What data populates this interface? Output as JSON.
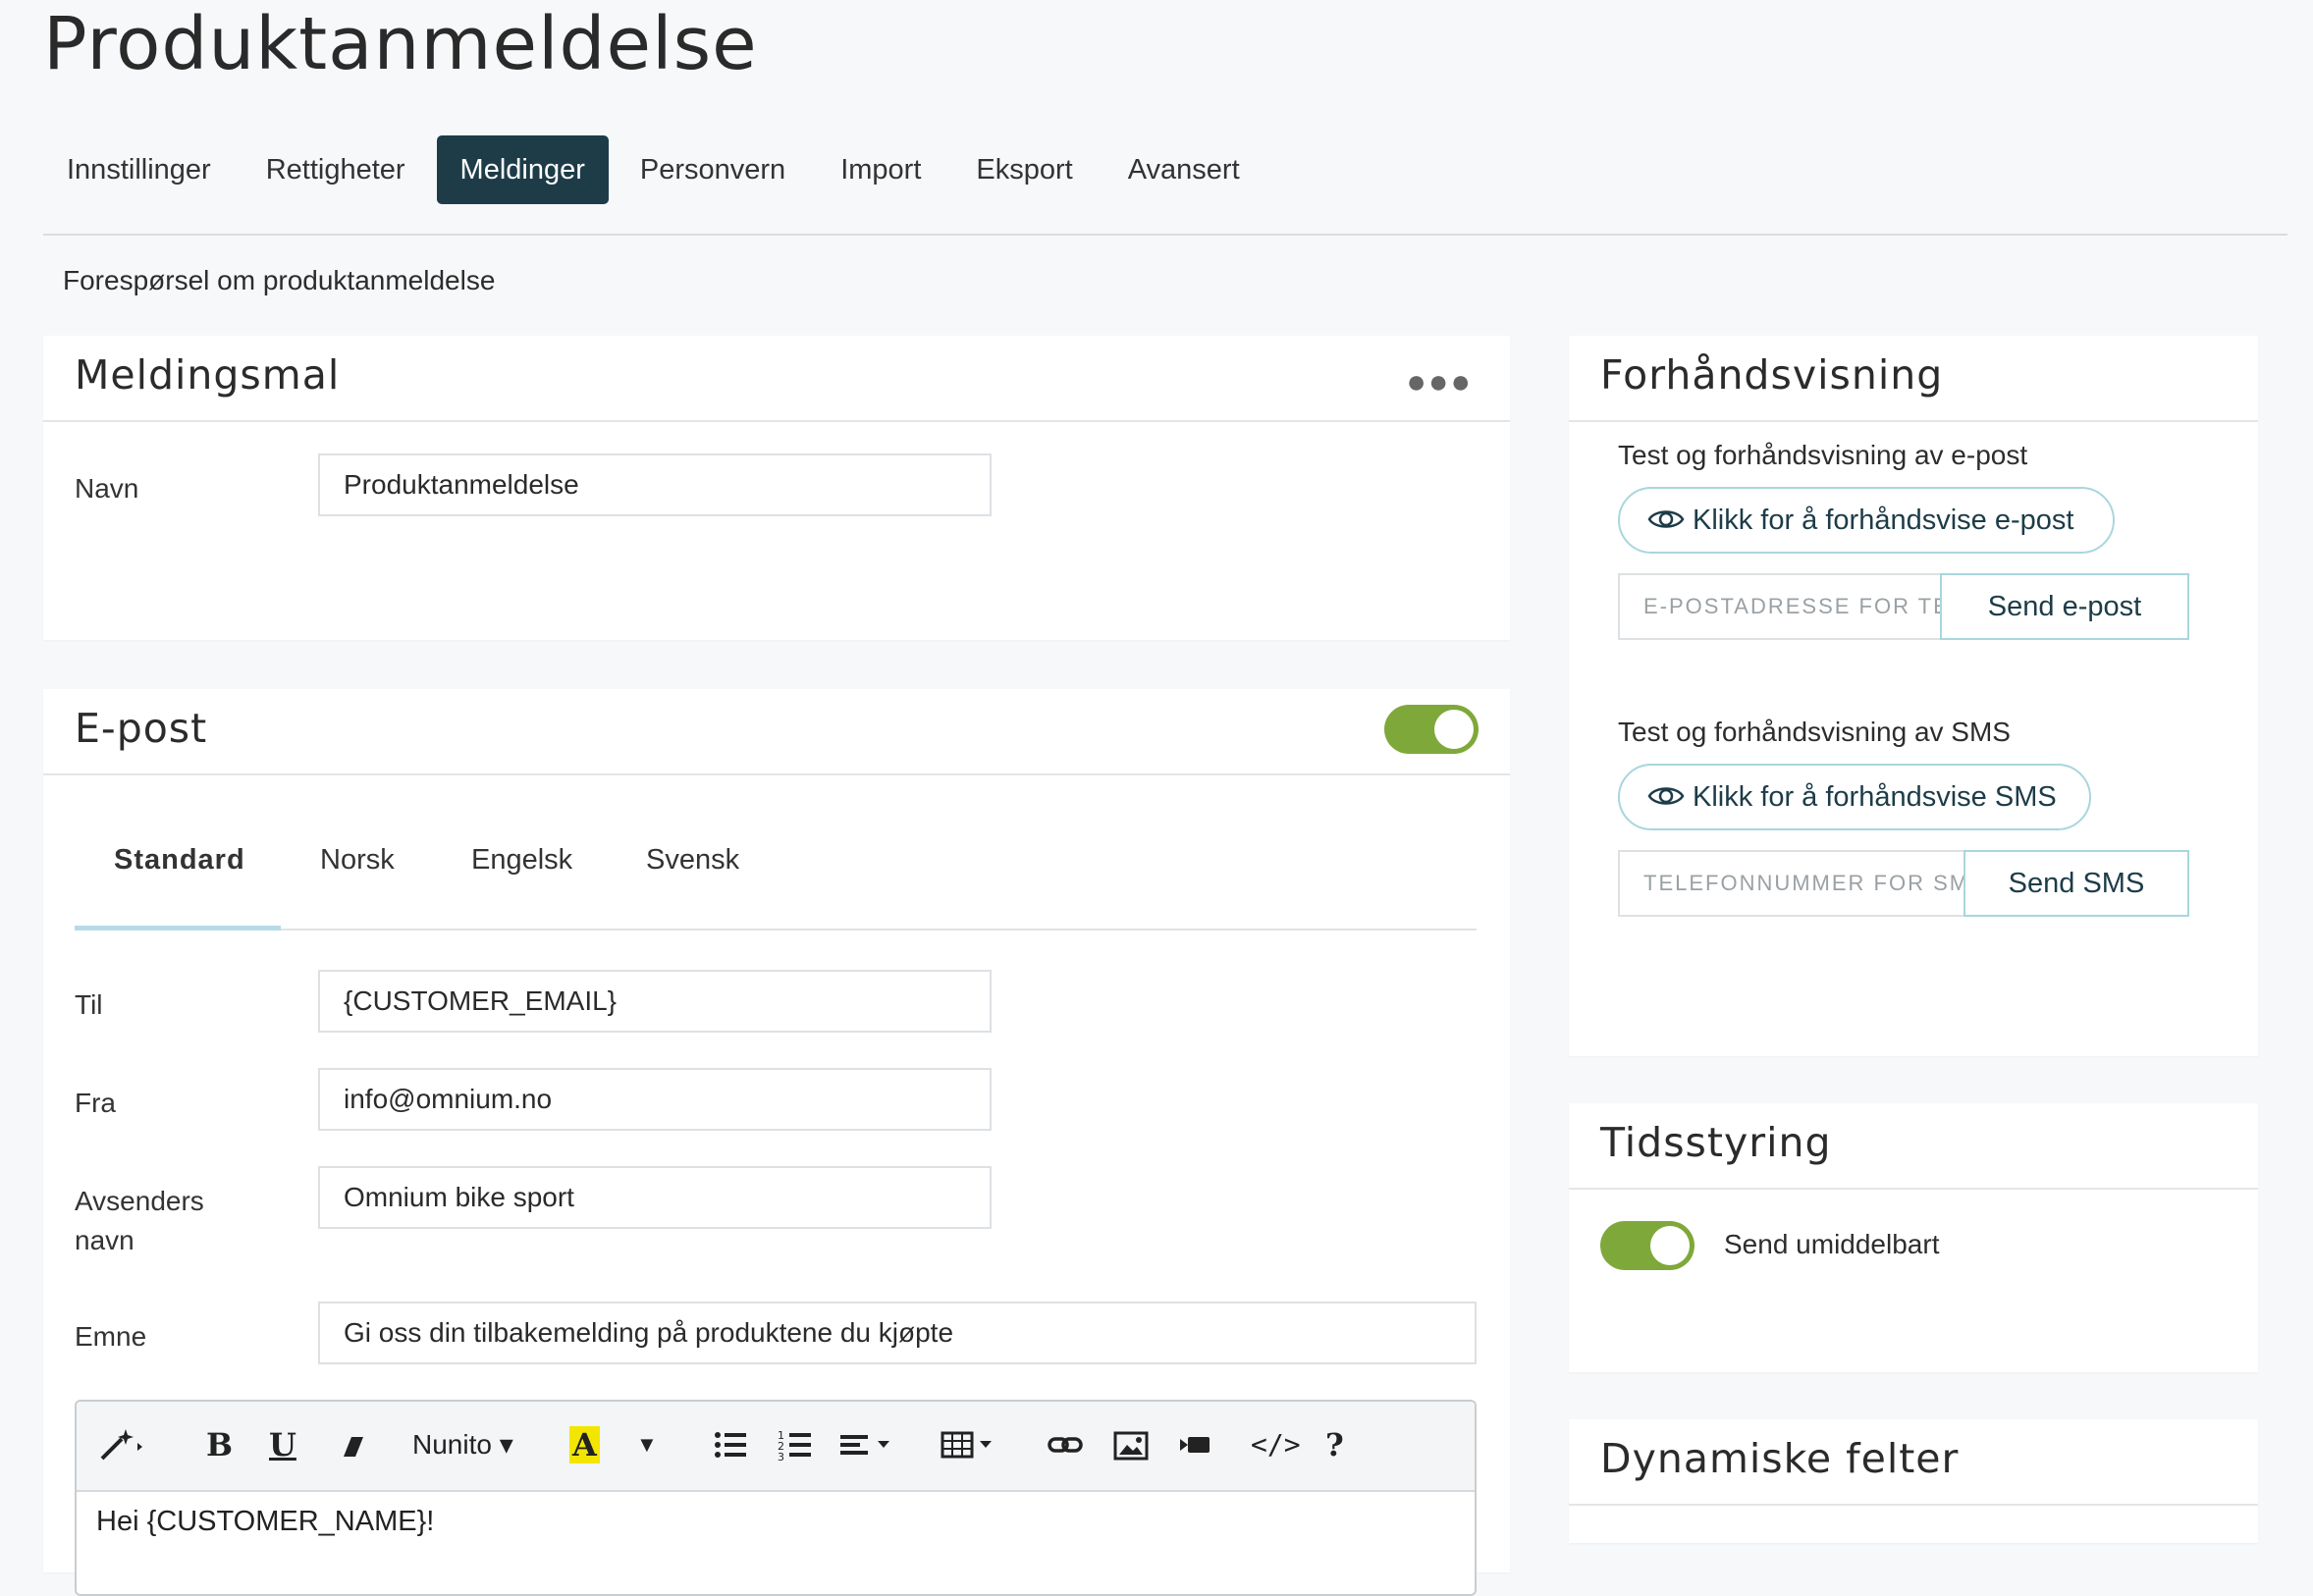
{
  "page": {
    "title": "Produktanmeldelse",
    "subtitle": "Forespørsel om produktanmeldelse"
  },
  "tabs": [
    {
      "label": "Innstillinger",
      "active": false
    },
    {
      "label": "Rettigheter",
      "active": false
    },
    {
      "label": "Meldinger",
      "active": true
    },
    {
      "label": "Personvern",
      "active": false
    },
    {
      "label": "Import",
      "active": false
    },
    {
      "label": "Eksport",
      "active": false
    },
    {
      "label": "Avansert",
      "active": false
    }
  ],
  "template_card": {
    "title": "Meldingsmal",
    "more_icon": "more-horizontal-icon",
    "name_label": "Navn",
    "name_value": "Produktanmeldelse"
  },
  "email_card": {
    "title": "E-post",
    "enabled": true,
    "lang_tabs": [
      "Standard",
      "Norsk",
      "Engelsk",
      "Svensk"
    ],
    "active_lang": "Standard",
    "fields": {
      "to_label": "Til",
      "to_value": "{CUSTOMER_EMAIL}",
      "from_label": "Fra",
      "from_value": "info@omnium.no",
      "sender_label_1": "Avsenders",
      "sender_label_2": "navn",
      "sender_value": "Omnium bike sport",
      "subject_label": "Emne",
      "subject_value": "Gi oss din tilbakemelding på produktene du kjøpte"
    },
    "editor": {
      "font": "Nunito",
      "body_text": "Hei {CUSTOMER_NAME}!",
      "toolbar_icons": [
        "magic-wand-icon",
        "bold-icon",
        "underline-icon",
        "eraser-icon",
        "font-dropdown",
        "text-color-icon",
        "color-caret-icon",
        "bullet-list-icon",
        "numbered-list-icon",
        "align-icon",
        "table-icon",
        "link-icon",
        "image-icon",
        "video-icon",
        "code-view-icon",
        "help-icon"
      ]
    }
  },
  "preview_card": {
    "title": "Forhåndsvisning",
    "email_label": "Test og forhåndsvisning av e-post",
    "email_preview_button": "Klikk for å forhåndsvise e-post",
    "email_placeholder": "E-POSTADRESSE FOR TE",
    "send_email_button": "Send e-post",
    "sms_label": "Test og forhåndsvisning av SMS",
    "sms_preview_button": "Klikk for å forhåndsvise SMS",
    "sms_placeholder": "TELEFONNUMMER FOR SM",
    "send_sms_button": "Send SMS"
  },
  "schedule_card": {
    "title": "Tidsstyring",
    "send_now_label": "Send umiddelbart",
    "send_now_enabled": true
  },
  "dynamic_card": {
    "title": "Dynamiske felter"
  },
  "colors": {
    "accent_dark": "#1d3c48",
    "toggle_green": "#7fa83a",
    "outline_teal": "#a9d6de"
  }
}
